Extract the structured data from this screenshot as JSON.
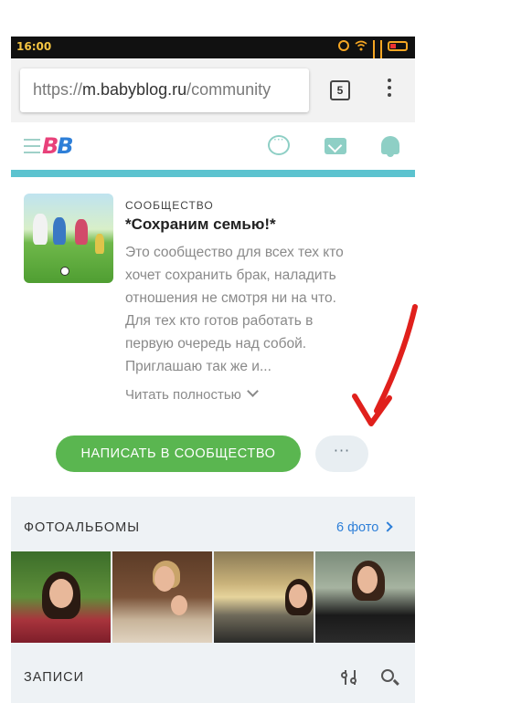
{
  "status_bar": {
    "time": "16:00"
  },
  "browser": {
    "url_prefix": "https://",
    "url_host": "m.babyblog.ru",
    "url_path": "/community",
    "tab_count": "5"
  },
  "site": {
    "logo_text_1": "B",
    "logo_text_2": "B"
  },
  "community": {
    "label": "СООБЩЕСТВО",
    "title": "*Сохраним семью!*",
    "description_lines": [
      "Это сообщество для всех тех кто",
      "хочет сохранить брак, наладить",
      "отношения не смотря ни на что.",
      "Для тех кто готов работать в",
      "первую очередь над собой.",
      "Приглашаю так же и..."
    ],
    "read_more": "Читать полностью",
    "write_button": "НАПИСАТЬ В СООБЩЕСТВО",
    "more_button": "···"
  },
  "albums": {
    "title": "ФОТОАЛЬБОМЫ",
    "count": "6 фото",
    "photo_names": [
      "photo-1",
      "photo-2",
      "photo-3",
      "photo-4"
    ]
  },
  "posts": {
    "title": "ЗАПИСИ"
  },
  "colors": {
    "accent_teal": "#5cc3cf",
    "button_green": "#5ab650",
    "link_blue": "#2d7fd8",
    "annotation_red": "#e0201c"
  },
  "icons": [
    "hamburger-icon",
    "chat-icon",
    "mail-icon",
    "bell-icon",
    "chevron-down-icon",
    "chevron-right-icon",
    "filter-icon",
    "search-icon",
    "menu-dots-icon"
  ]
}
